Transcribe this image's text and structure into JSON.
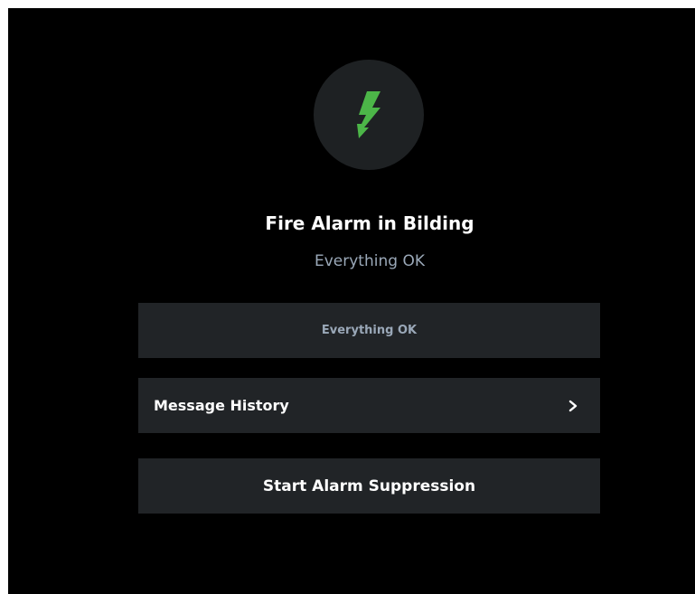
{
  "device": {
    "icon": "lightning-bolt-icon",
    "icon_color": "#4cb648",
    "title": "Fire Alarm in Bilding",
    "status_text": "Everything OK"
  },
  "status_box": {
    "text": "Everything OK"
  },
  "message_history": {
    "label": "Message History",
    "icon": "chevron-right-icon"
  },
  "suppression": {
    "button_label": "Start Alarm Suppression"
  },
  "colors": {
    "background": "#000000",
    "card": "#212427",
    "icon_circle": "#1e2123",
    "muted_text": "#9aa8b8",
    "accent_green": "#4cb648"
  }
}
